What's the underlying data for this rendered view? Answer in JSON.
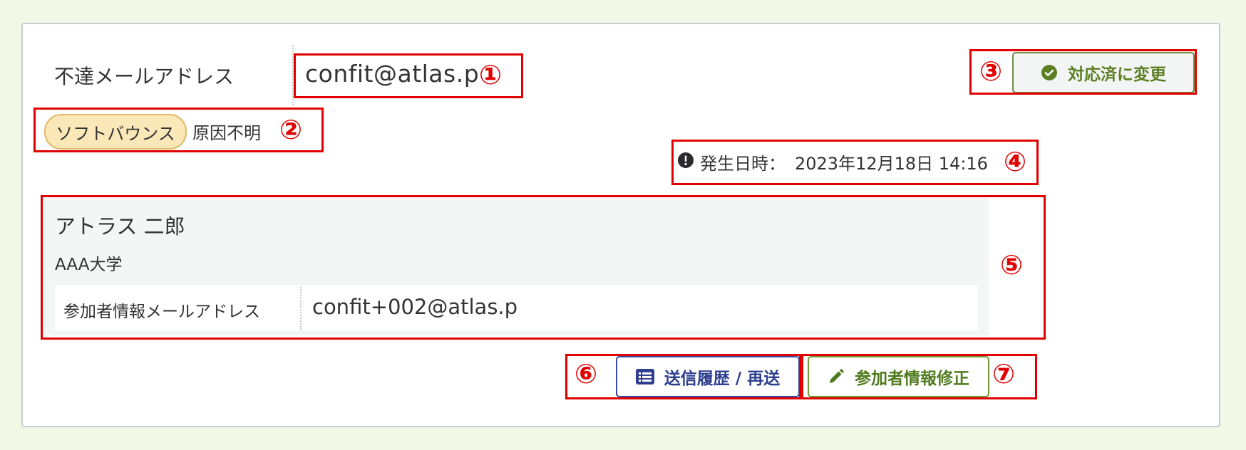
{
  "bounce": {
    "label": "不達メールアドレス",
    "email": "confit@atlas.p",
    "badge": "ソフトバウンス",
    "reason": "原因不明",
    "occurred_label": "発生日時：",
    "occurred_value": "2023年12月18日 14:16"
  },
  "actions": {
    "mark_resolved": "対応済に変更",
    "send_history": "送信履歴 / 再送",
    "edit_participant": "参加者情報修正"
  },
  "participant": {
    "name": "アトラス 二郎",
    "affiliation": "AAA大学",
    "email_label": "参加者情報メールアドレス",
    "email": "confit+002@atlas.p"
  },
  "annotations": {
    "n1": "①",
    "n2": "②",
    "n3": "③",
    "n4": "④",
    "n5": "⑤",
    "n6": "⑥",
    "n7": "⑦"
  },
  "colors": {
    "background": "#f2f8e6",
    "annotation_red": "#e00000",
    "badge_fill": "#fbe8b8",
    "resolved_green": "#5c7f24",
    "history_blue": "#2e3f8f"
  }
}
